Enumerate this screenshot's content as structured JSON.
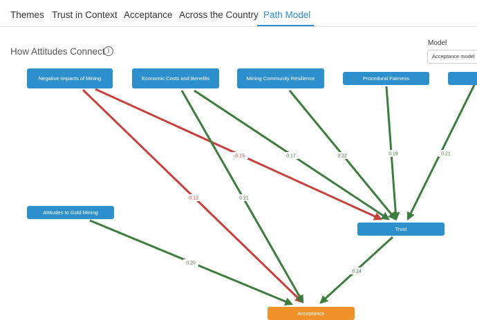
{
  "tabs": [
    {
      "label": "Themes",
      "active": false
    },
    {
      "label": "Trust in Context",
      "active": false
    },
    {
      "label": "Acceptance",
      "active": false
    },
    {
      "label": "Across the Country",
      "active": false
    },
    {
      "label": "Path Model",
      "active": true
    }
  ],
  "section": {
    "title": "How Attitudes Connect",
    "info_icon": "info-icon"
  },
  "model_select": {
    "label": "Model",
    "value": "Acceptance model"
  },
  "colors": {
    "node": "#2d8fcb",
    "outcome": "#f0912a",
    "positive": "#3c7d3e",
    "negative": "#c9403a",
    "accent": "#2e8ccf"
  },
  "nodes": {
    "negative_impacts": "Negative Impacts of Mining",
    "economic_costs": "Economic Costs and Benefits",
    "mining_resilience": "Mining Community Resilience",
    "procedural_fairness": "Procedural Fairness",
    "offscreen": "",
    "attitudes_gold": "Attitudes to Gold Mining",
    "trust": "Trust",
    "acceptance": "Acceptance"
  },
  "paths": [
    {
      "from": "negative_impacts",
      "to": "trust",
      "coefficient": "-0.12",
      "sign": "negative"
    },
    {
      "from": "negative_impacts",
      "to": "acceptance",
      "coefficient": "-0.15",
      "sign": "negative"
    },
    {
      "from": "economic_costs",
      "to": "trust",
      "coefficient": "0.17",
      "sign": "positive"
    },
    {
      "from": "economic_costs",
      "to": "acceptance",
      "coefficient": "0.21",
      "sign": "positive"
    },
    {
      "from": "mining_resilience",
      "to": "trust",
      "coefficient": "0.22",
      "sign": "positive"
    },
    {
      "from": "procedural_fairness",
      "to": "trust",
      "coefficient": "0.19",
      "sign": "positive"
    },
    {
      "from": "offscreen",
      "to": "trust",
      "coefficient": "0.21",
      "sign": "positive"
    },
    {
      "from": "attitudes_gold",
      "to": "acceptance",
      "coefficient": "0.20",
      "sign": "positive"
    },
    {
      "from": "trust",
      "to": "acceptance",
      "coefficient": "0.24",
      "sign": "positive"
    }
  ]
}
